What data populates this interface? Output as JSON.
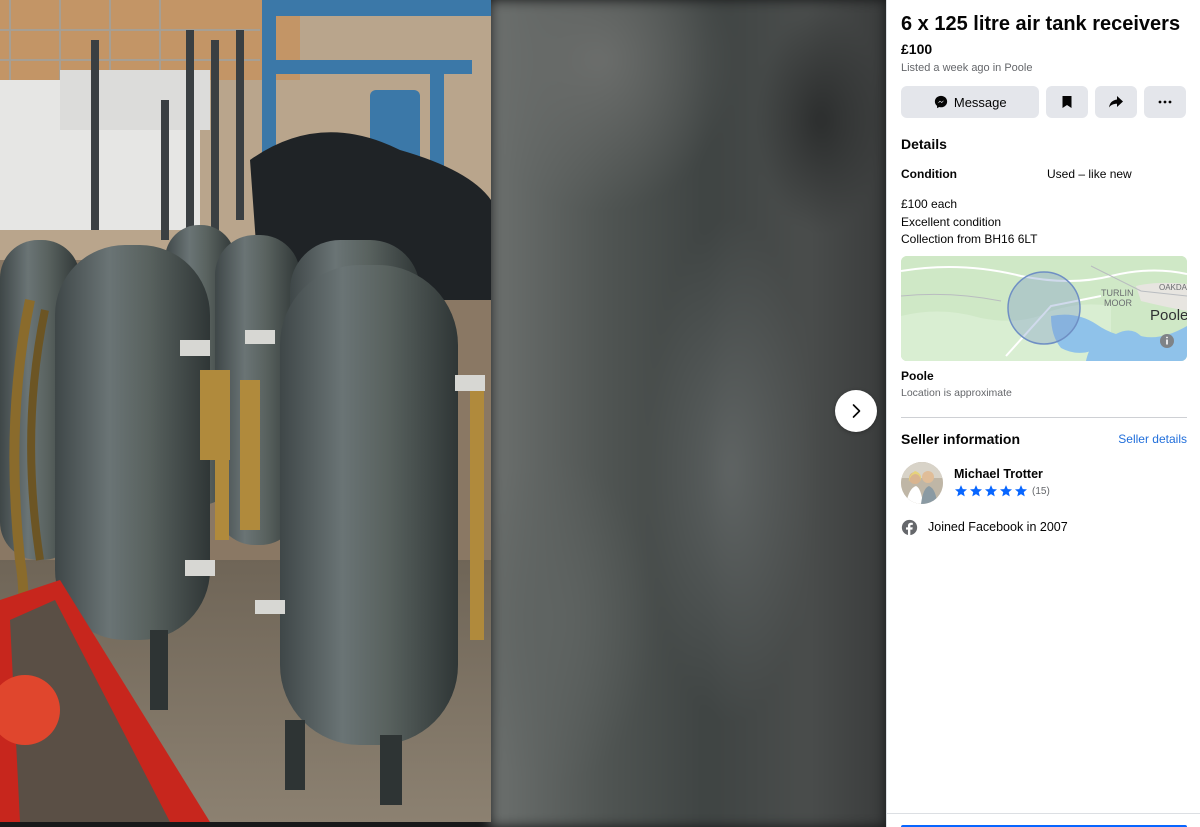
{
  "listing": {
    "title": "6 x 125 litre air tank receivers",
    "price": "£100",
    "listed": "Listed a week ago in Poole"
  },
  "actions": {
    "message_label": "Message",
    "save_icon": "bookmark-icon",
    "share_icon": "share-icon",
    "more_icon": "more-icon"
  },
  "details": {
    "heading": "Details",
    "condition_label": "Condition",
    "condition_value": "Used – like new",
    "description": [
      "£100 each",
      "Excellent condition",
      "Collection from BH16 6LT"
    ]
  },
  "map": {
    "labels": {
      "turlin": "TURLIN",
      "moor": "MOOR",
      "oakdale": "OAKDA",
      "poole": "Poole"
    },
    "info_icon": "info-icon"
  },
  "location": {
    "name": "Poole",
    "note": "Location is approximate"
  },
  "seller": {
    "heading": "Seller information",
    "details_link": "Seller details",
    "name": "Michael Trotter",
    "rating_stars": 5,
    "rating_count": "(15)",
    "joined": "Joined Facebook in 2007"
  },
  "colors": {
    "accent": "#0866ff",
    "link": "#216fdb",
    "button_bg": "#e4e6eb",
    "secondary_text": "#65676b"
  }
}
